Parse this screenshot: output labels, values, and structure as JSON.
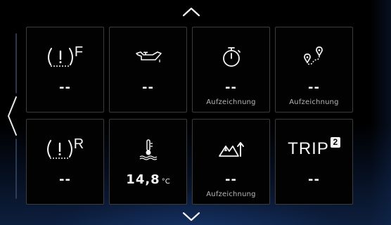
{
  "tiles": [
    {
      "icon": "tire-pressure-front-icon",
      "letter": "F",
      "value": "--",
      "sub": ""
    },
    {
      "icon": "oil-level-icon",
      "value": "--",
      "sub": ""
    },
    {
      "icon": "stopwatch-icon",
      "value": "--",
      "sub": "Aufzeichnung"
    },
    {
      "icon": "route-pin-icon",
      "value": "--",
      "sub": "Aufzeichnung"
    },
    {
      "icon": "tire-pressure-rear-icon",
      "letter": "R",
      "value": "--",
      "sub": ""
    },
    {
      "icon": "coolant-temperature-icon",
      "value": "14,8",
      "unit": "°C",
      "sub": ""
    },
    {
      "icon": "altitude-icon",
      "value": "--",
      "sub": "Aufzeichnung"
    },
    {
      "icon": "trip-icon",
      "trip_label": "TRIP",
      "trip_number": "2",
      "value": "--",
      "sub": ""
    }
  ],
  "colors": {
    "background": "#000000",
    "tile_border": "#3c3c3c",
    "text": "#f4f4f4",
    "subtext": "#b8b8b8",
    "accent_glow": "#1e468c"
  }
}
